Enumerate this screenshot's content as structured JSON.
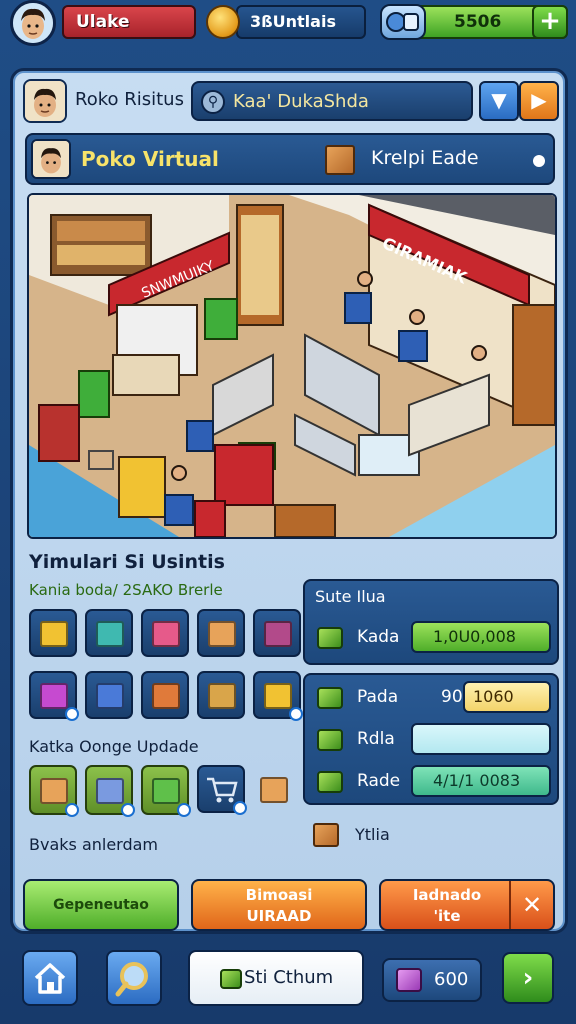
{
  "hud": {
    "player_name": "Ulake",
    "coins": "3ßUntlais",
    "cash": "5506",
    "plus_label": "+"
  },
  "owner": {
    "name": "Roko Risitus",
    "search_value": "Kaa' DukaShda",
    "btn_left_icon": "▼",
    "btn_right_icon": "▶"
  },
  "store": {
    "name": "Poko Virtual",
    "status": "Krelpi Eade"
  },
  "scene": {
    "sign_left": "SNWMUIKY",
    "sign_right": "GIRAMIAK"
  },
  "inventory": {
    "title": "Yimulari Si Usintis",
    "subtitle": "Kania boda/ 2SAKO Brerle",
    "row1_colors": [
      "#f1c232",
      "#3fb9b0",
      "#e65a8a",
      "#e7a35a",
      "#b24a8a"
    ],
    "row2_colors": [
      "#c64ad0",
      "#4a7ad8",
      "#e07a3a",
      "#d9a54a",
      "#f1c232"
    ],
    "upgrade_title": "Katka Oonge Updade",
    "upgrade_colors": [
      "#e7a35a",
      "#7a9ae0",
      "#5fc04a"
    ],
    "footer_label": "Bvaks anlerdam"
  },
  "stats": {
    "title": "Sute Ilua",
    "main_label": "Kada",
    "main_value": "1,0U0,008",
    "rows": [
      {
        "label": "Pada",
        "prefix": "90",
        "value": "1060"
      },
      {
        "label": "Rdla",
        "prefix": "",
        "value": ""
      },
      {
        "label": "Rade",
        "prefix": "",
        "value": "4/1/1 0083"
      }
    ],
    "extra_label": "Ytlia"
  },
  "actions": {
    "left": "Gepeneutao",
    "middle_top": "Bimoasi",
    "middle_bottom": "UIRAAD",
    "right_top": "Iadnado",
    "right_bottom": "'ite",
    "close_icon": "✕"
  },
  "bottom": {
    "chat_label": "Sti Cthum",
    "gem_count": "600",
    "next_icon": "›"
  }
}
